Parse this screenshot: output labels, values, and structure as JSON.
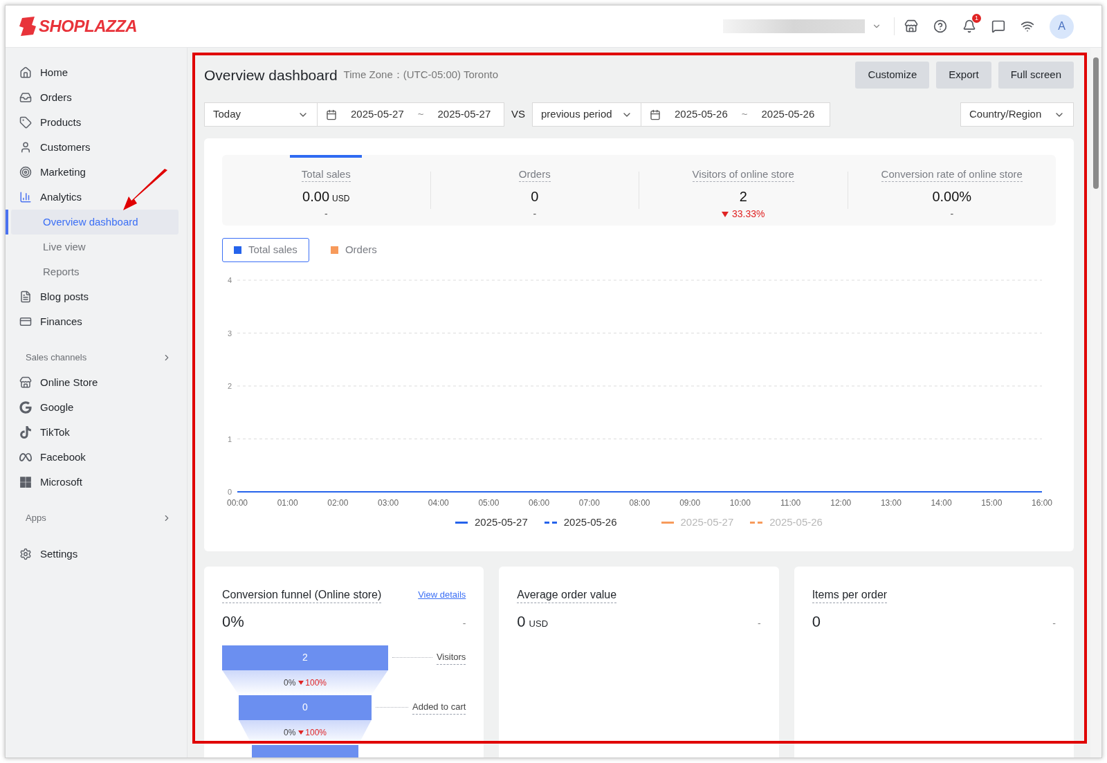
{
  "header": {
    "logo": "SHOPLAZZA",
    "notifications": "1",
    "avatar": "A"
  },
  "sidebar": {
    "items": [
      {
        "label": "Home",
        "selected": false
      },
      {
        "label": "Orders",
        "selected": false
      },
      {
        "label": "Products",
        "selected": false
      },
      {
        "label": "Customers",
        "selected": false
      },
      {
        "label": "Marketing",
        "selected": false
      },
      {
        "label": "Analytics",
        "selected": false,
        "expanded": true,
        "children": [
          {
            "label": "Overview dashboard",
            "selected": true
          },
          {
            "label": "Live view",
            "selected": false
          },
          {
            "label": "Reports",
            "selected": false
          }
        ]
      },
      {
        "label": "Blog posts",
        "selected": false
      },
      {
        "label": "Finances",
        "selected": false
      }
    ],
    "sales_channels": {
      "title": "Sales channels",
      "items": [
        {
          "label": "Online Store"
        },
        {
          "label": "Google"
        },
        {
          "label": "TikTok"
        },
        {
          "label": "Facebook"
        },
        {
          "label": "Microsoft"
        }
      ]
    },
    "apps": {
      "title": "Apps"
    },
    "settings": "Settings"
  },
  "page": {
    "title": "Overview dashboard",
    "time_zone_label": "Time Zone：",
    "time_zone": "(UTC-05:00) Toronto",
    "buttons": [
      "Customize",
      "Export",
      "Full screen"
    ]
  },
  "filters": {
    "period": "Today",
    "start": "2025-05-27",
    "end": "2025-05-27",
    "separator": "~",
    "vs": "VS",
    "compare": "previous period",
    "compare_start": "2025-05-26",
    "compare_end": "2025-05-26",
    "region": "Country/Region"
  },
  "metrics": [
    {
      "label": "Total sales",
      "value": "0.00",
      "unit": "USD",
      "change": "-",
      "down": false,
      "selected": true
    },
    {
      "label": "Orders",
      "value": "0",
      "change": "-",
      "down": false,
      "selected": false
    },
    {
      "label": "Visitors of online store",
      "value": "2",
      "change": "33.33%",
      "down": true,
      "selected": false
    },
    {
      "label": "Conversion rate of online store",
      "value": "0.00%",
      "change": "-",
      "down": false,
      "selected": false
    }
  ],
  "chart_toggles": [
    {
      "label": "Total sales",
      "color": "#2563eb",
      "selected": true
    },
    {
      "label": "Orders",
      "color": "#f79a5b",
      "selected": false
    }
  ],
  "chart": {
    "chart_data": {
      "type": "line",
      "grid": true,
      "x": [
        "00:00",
        "01:00",
        "02:00",
        "03:00",
        "04:00",
        "05:00",
        "06:00",
        "07:00",
        "08:00",
        "09:00",
        "10:00",
        "11:00",
        "12:00",
        "13:00",
        "14:00",
        "15:00",
        "16:00"
      ],
      "ylim": [
        0,
        4
      ],
      "yticks": [
        0,
        1,
        2,
        3,
        4
      ],
      "series": [
        {
          "name": "2025-05-27",
          "color": "#2563eb",
          "line_style": "solid",
          "values": [
            0,
            0,
            0,
            0,
            0,
            0,
            0,
            0,
            0,
            0,
            0,
            0,
            0,
            0,
            0,
            0,
            0
          ]
        },
        {
          "name": "2025-05-26",
          "color": "#2563eb",
          "line_style": "dashed",
          "values": [
            0,
            0,
            0,
            0,
            0,
            0,
            0,
            0,
            0,
            0,
            0,
            0,
            0,
            0,
            0,
            0,
            0
          ]
        }
      ]
    },
    "hidden_series": [
      {
        "label": "2025-05-27",
        "color": "#f79a5b",
        "dashed": false
      },
      {
        "label": "2025-05-26",
        "color": "#f79a5b",
        "dashed": true
      }
    ]
  },
  "cards": [
    {
      "kind": "funnel",
      "title": "Conversion funnel (Online store)",
      "link": "View details",
      "value": "0%",
      "change": "-",
      "stages": [
        {
          "value": "2",
          "label": "Visitors",
          "rate": "0%",
          "drop": "100%"
        },
        {
          "value": "0",
          "label": "Added to cart",
          "rate": "0%",
          "drop": "100%"
        }
      ]
    },
    {
      "kind": "metric",
      "title": "Average order value",
      "value": "0",
      "unit": "USD",
      "change": "-"
    },
    {
      "kind": "metric",
      "title": "Items per order",
      "value": "0",
      "change": "-"
    }
  ]
}
